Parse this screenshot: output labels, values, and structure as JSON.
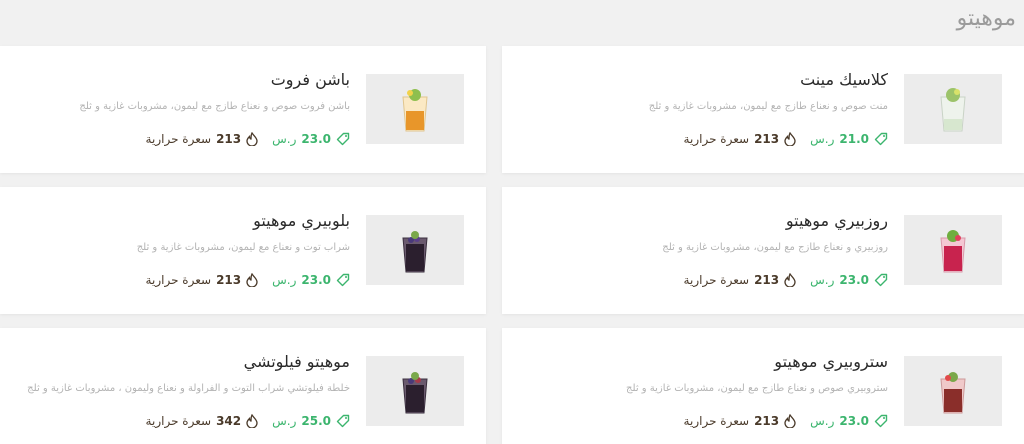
{
  "section": {
    "title": "موهيتو"
  },
  "items": [
    {
      "name": "كلاسيك مينت",
      "description": "منت صوص و نعناع طازج مع ليمون، مشروبات غازية و ثلج",
      "price_value": "21.0",
      "currency": "ر.س",
      "calories_value": "213",
      "calories_label": "سعرة حرارية",
      "drink": "mint"
    },
    {
      "name": "باشن فروت",
      "description": "باشن فروت صوص و نعناع طازج مع ليمون، مشروبات غازية و ثلج",
      "price_value": "23.0",
      "currency": "ر.س",
      "calories_value": "213",
      "calories_label": "سعرة حرارية",
      "drink": "passion"
    },
    {
      "name": "روزبيري موهيتو",
      "description": "روزبيري و نعناع طازج مع ليمون، مشروبات غازية و ثلج",
      "price_value": "23.0",
      "currency": "ر.س",
      "calories_value": "213",
      "calories_label": "سعرة حرارية",
      "drink": "rose"
    },
    {
      "name": "بلوبيري موهيتو",
      "description": "شراب توت و نعناع مع ليمون، مشروبات غازية و ثلج",
      "price_value": "23.0",
      "currency": "ر.س",
      "calories_value": "213",
      "calories_label": "سعرة حرارية",
      "drink": "blue"
    },
    {
      "name": "ستروبيري موهيتو",
      "description": "ستروبيري صوص و نعناع طازج مع ليمون، مشروبات غازية و ثلج",
      "price_value": "23.0",
      "currency": "ر.س",
      "calories_value": "213",
      "calories_label": "سعرة حرارية",
      "drink": "straw"
    },
    {
      "name": "موهيتو فيلوتشي",
      "description": "خلطة فيلوتشي شراب التوت و الفراولة و نعناع وليمون ، مشروبات غازية و ثلج",
      "price_value": "25.0",
      "currency": "ر.س",
      "calories_value": "342",
      "calories_label": "سعرة حرارية",
      "drink": "blue"
    }
  ],
  "colors": {
    "accent_green": "#3cb56e",
    "calorie_brown": "#4a3a2a",
    "title_gray": "#9b9b9b"
  },
  "icons": {
    "price": "price-tag-icon",
    "calories": "flame-icon"
  }
}
